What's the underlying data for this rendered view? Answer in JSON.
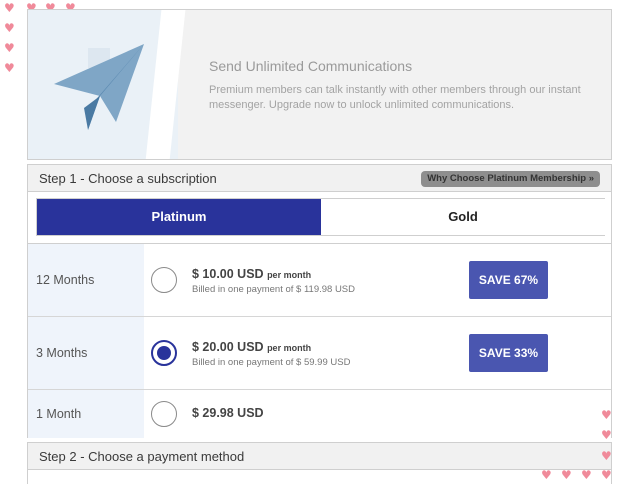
{
  "banner": {
    "title": "Send Unlimited Communications",
    "text": "Premium members can talk instantly with other members through our instant messenger. Upgrade now to unlock unlimited communications."
  },
  "step1": {
    "title": "Step 1 - Choose a subscription",
    "why_label": "Why Choose Platinum Membership »"
  },
  "plans": {
    "tabs": [
      {
        "label": "Platinum",
        "selected": true
      },
      {
        "label": "Gold",
        "selected": false
      }
    ]
  },
  "subscriptions": [
    {
      "duration": "12 Months",
      "price": "$ 10.00 USD",
      "unit": "per month",
      "billed": "Billed in one payment of $ 119.98 USD",
      "save": "SAVE 67%",
      "selected": false
    },
    {
      "duration": "3 Months",
      "price": "$ 20.00 USD",
      "unit": "per month",
      "billed": "Billed in one payment of $ 59.99 USD",
      "save": "SAVE 33%",
      "selected": true
    },
    {
      "duration": "1 Month",
      "price": "$ 29.98 USD",
      "selected": false
    }
  ],
  "step2": {
    "title": "Step 2 - Choose a payment method"
  },
  "icons": {
    "heart": "heart-icon",
    "plane": "paper-plane-icon"
  },
  "colors": {
    "accent": "#29339b",
    "save_button": "#4a56b0",
    "heart": "#f08a9a"
  }
}
